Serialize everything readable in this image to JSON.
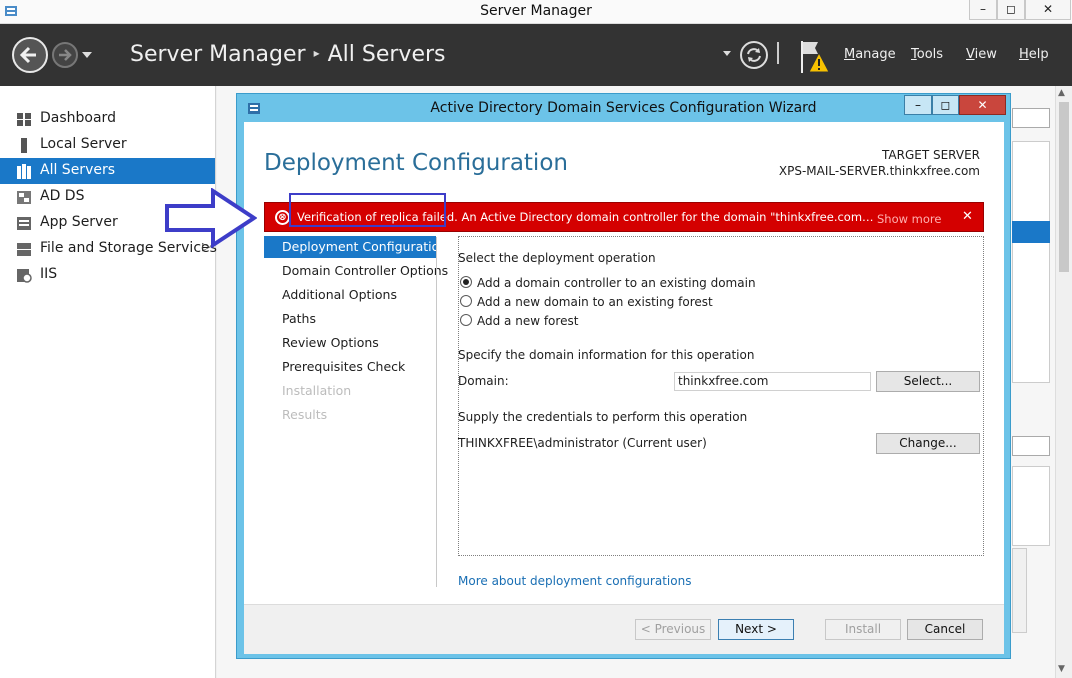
{
  "os_window": {
    "title": "Server Manager",
    "controls": [
      "–",
      "◻",
      "✕"
    ]
  },
  "header": {
    "breadcrumb_root": "Server Manager",
    "breadcrumb_sep": "▸",
    "breadcrumb_current": "All Servers",
    "menus": [
      "Manage",
      "Tools",
      "View",
      "Help"
    ],
    "menu_accelerators": [
      "M",
      "T",
      "V",
      "H"
    ]
  },
  "leftnav": {
    "items": [
      {
        "label": "Dashboard",
        "icon": "dashboard-icon"
      },
      {
        "label": "Local Server",
        "icon": "server-icon"
      },
      {
        "label": "All Servers",
        "icon": "servers-icon",
        "selected": true
      },
      {
        "label": "AD DS",
        "icon": "adds-icon"
      },
      {
        "label": "App Server",
        "icon": "app-server-icon"
      },
      {
        "label": "File and Storage Services",
        "icon": "storage-icon",
        "expand": "▷"
      },
      {
        "label": "IIS",
        "icon": "iis-icon"
      }
    ]
  },
  "wizard": {
    "title": "Active Directory Domain Services Configuration Wizard",
    "heading": "Deployment Configuration",
    "target_label": "TARGET SERVER",
    "target_name": "XPS-MAIL-SERVER.thinkxfree.com",
    "error": {
      "text": "Verification of replica failed. An Active Directory domain controller for the domain \"thinkxfree.com\" could n...",
      "more": "Show more",
      "close": "✕",
      "icon": "⊗"
    },
    "steps": [
      {
        "label": "Deployment Configuration",
        "state": "selected"
      },
      {
        "label": "Domain Controller Options",
        "state": "normal"
      },
      {
        "label": "Additional Options",
        "state": "normal"
      },
      {
        "label": "Paths",
        "state": "normal"
      },
      {
        "label": "Review Options",
        "state": "normal"
      },
      {
        "label": "Prerequisites Check",
        "state": "normal"
      },
      {
        "label": "Installation",
        "state": "disabled"
      },
      {
        "label": "Results",
        "state": "disabled"
      }
    ],
    "operation_label": "Select the deployment operation",
    "operations": [
      {
        "label": "Add a domain controller to an existing domain",
        "checked": true
      },
      {
        "label": "Add a new domain to an existing forest",
        "checked": false
      },
      {
        "label": "Add a new forest",
        "checked": false
      }
    ],
    "domain_info_label": "Specify the domain information for this operation",
    "domain_label": "Domain:",
    "domain_value": "thinkxfree.com",
    "select_button": "Select...",
    "credentials_label": "Supply the credentials to perform this operation",
    "credentials_value": "THINKXFREE\\administrator (Current user)",
    "change_button": "Change...",
    "more_link": "More about deployment configurations",
    "footer": {
      "previous": "< Previous",
      "next": "Next >",
      "install": "Install",
      "cancel": "Cancel"
    }
  },
  "colors": {
    "header_bg": "#333333",
    "nav_selected": "#1a78c8",
    "wizard_frame": "#6cc3e8",
    "error_bg": "#d40000",
    "heading": "#2a6e99",
    "annotation": "#3d3dc8"
  }
}
